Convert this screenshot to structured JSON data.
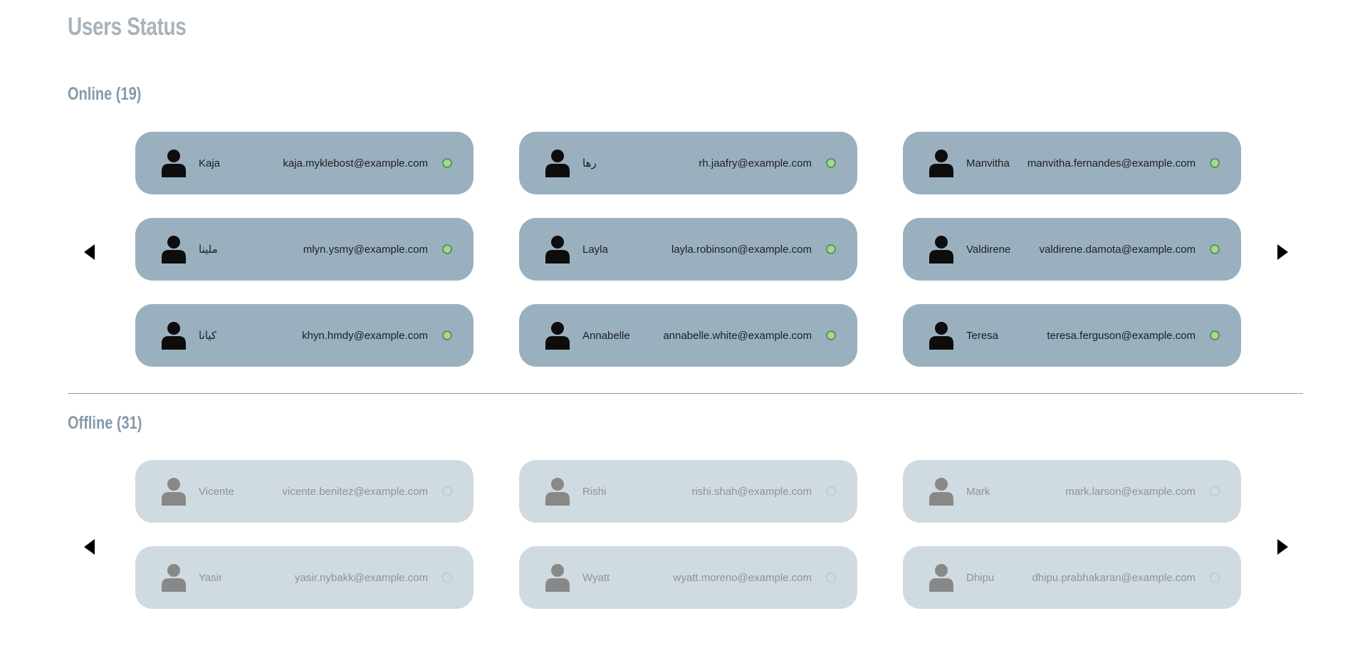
{
  "page": {
    "title": "Users Status"
  },
  "online": {
    "title": "Online (19)",
    "users": [
      {
        "name": "Kaja",
        "email": "kaja.myklebost@example.com"
      },
      {
        "name": "رها",
        "email": "rh.jaafry@example.com"
      },
      {
        "name": "Manvitha",
        "email": "manvitha.fernandes@example.com"
      },
      {
        "name": "ملینا",
        "email": "mlyn.ysmy@example.com"
      },
      {
        "name": "Layla",
        "email": "layla.robinson@example.com"
      },
      {
        "name": "Valdirene",
        "email": "valdirene.damota@example.com"
      },
      {
        "name": "کیانا",
        "email": "khyn.hmdy@example.com"
      },
      {
        "name": "Annabelle",
        "email": "annabelle.white@example.com"
      },
      {
        "name": "Teresa",
        "email": "teresa.ferguson@example.com"
      }
    ]
  },
  "offline": {
    "title": "Offline (31)",
    "users": [
      {
        "name": "Vicente",
        "email": "vicente.benitez@example.com"
      },
      {
        "name": "Rishi",
        "email": "rishi.shah@example.com"
      },
      {
        "name": "Mark",
        "email": "mark.larson@example.com"
      },
      {
        "name": "Yasir",
        "email": "yasir.nybakk@example.com"
      },
      {
        "name": "Wyatt",
        "email": "wyatt.moreno@example.com"
      },
      {
        "name": "Dhipu",
        "email": "dhipu.prabhakaran@example.com"
      }
    ]
  },
  "colors": {
    "online_card": "#9bb0bf",
    "offline_card": "#d0dae1",
    "online_indicator": "#a4da8c",
    "title": "#a7b3bd",
    "section_title": "#8599aa"
  },
  "icons": {
    "avatar": "user-avatar-icon",
    "prev": "arrow-left-icon",
    "next": "arrow-right-icon",
    "status": "status-dot"
  }
}
